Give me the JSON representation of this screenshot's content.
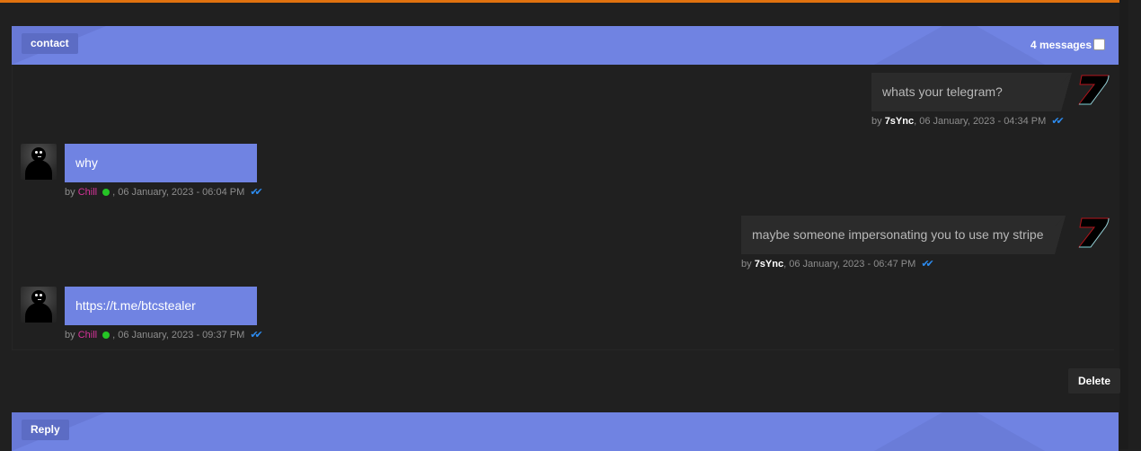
{
  "colors": {
    "accent": "#7083e2",
    "top_bar": "#e0720f",
    "background": "#202020",
    "outgoing_bubble": "#2b2b2b",
    "author_in": "#d6339a",
    "online": "#25c425",
    "read_check": "#2d8cf0"
  },
  "header": {
    "title": "contact",
    "message_count": "4 messages"
  },
  "messages": [
    {
      "direction": "outgoing",
      "text": "whats your telegram?",
      "by": "by",
      "author": "7sYnc",
      "timestamp": ", 06 January, 2023 - 04:34 PM",
      "avatar": "seven-logo-avatar",
      "read_icon": "double-check-icon"
    },
    {
      "direction": "incoming",
      "text": "why",
      "by": "by",
      "author": "Chill",
      "status": "online",
      "timestamp": ", 06 January, 2023 - 06:04 PM",
      "avatar": "stick-figure-avatar",
      "read_icon": "double-check-icon"
    },
    {
      "direction": "outgoing",
      "text": "maybe someone impersonating you to use my stripe",
      "by": "by",
      "author": "7sYnc",
      "timestamp": ", 06 January, 2023 - 06:47 PM",
      "avatar": "seven-logo-avatar",
      "read_icon": "double-check-icon"
    },
    {
      "direction": "incoming",
      "text": "https://t.me/btcstealer",
      "by": "by",
      "author": "Chill",
      "status": "online",
      "timestamp": ", 06 January, 2023 - 09:37 PM",
      "avatar": "stick-figure-avatar",
      "read_icon": "double-check-icon"
    }
  ],
  "actions": {
    "delete_label": "Delete",
    "reply_label": "Reply"
  },
  "icons": {
    "check": "✔✔"
  }
}
